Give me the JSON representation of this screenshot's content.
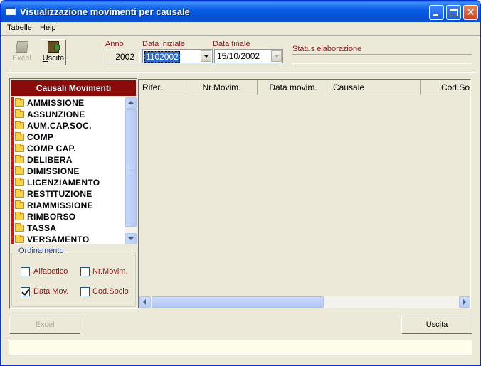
{
  "window": {
    "title": "Visualizzazione movimenti per causale"
  },
  "menu": {
    "items": [
      "Tabelle",
      "Help"
    ]
  },
  "toolbar": {
    "excel_label": "Excel",
    "uscita_label": "Uscita"
  },
  "filters": {
    "anno_label": "Anno",
    "anno_value": "2002",
    "data_iniziale_label": "Data iniziale",
    "data_iniziale_value": "1102002",
    "data_finale_label": "Data finale",
    "data_finale_value": "15/10/2002",
    "status_label": "Status elaborazione"
  },
  "causali": {
    "header": "Causali Movimenti",
    "items": [
      "AMMISSIONE",
      "ASSUNZIONE",
      "AUM.CAP.SOC.",
      "COMP",
      "COMP CAP.",
      "DELIBERA",
      "DIMISSIONE",
      "LICENZIAMENTO",
      "RESTITUZIONE",
      "RIAMMISSIONE",
      "RIMBORSO",
      "TASSA",
      "VERSAMENTO"
    ]
  },
  "ordinamento": {
    "legend": "Ordinamento",
    "options": [
      {
        "label": "Alfabetico",
        "checked": false
      },
      {
        "label": "Nr.Movim.",
        "checked": false
      },
      {
        "label": "Data Mov.",
        "checked": true
      },
      {
        "label": "Cod.Socio",
        "checked": false
      }
    ]
  },
  "grid": {
    "columns": [
      "Rifer.",
      "Nr.Movim.",
      "Data movim.",
      "Causale",
      "Cod.So"
    ]
  },
  "footer": {
    "excel_label": "Excel",
    "uscita_label": "Uscita"
  },
  "colors": {
    "titlebar": "#0553d9",
    "causali_header": "#8b0a0a",
    "label_red": "#8b1a1a",
    "list_stripe": "#d8101a"
  }
}
